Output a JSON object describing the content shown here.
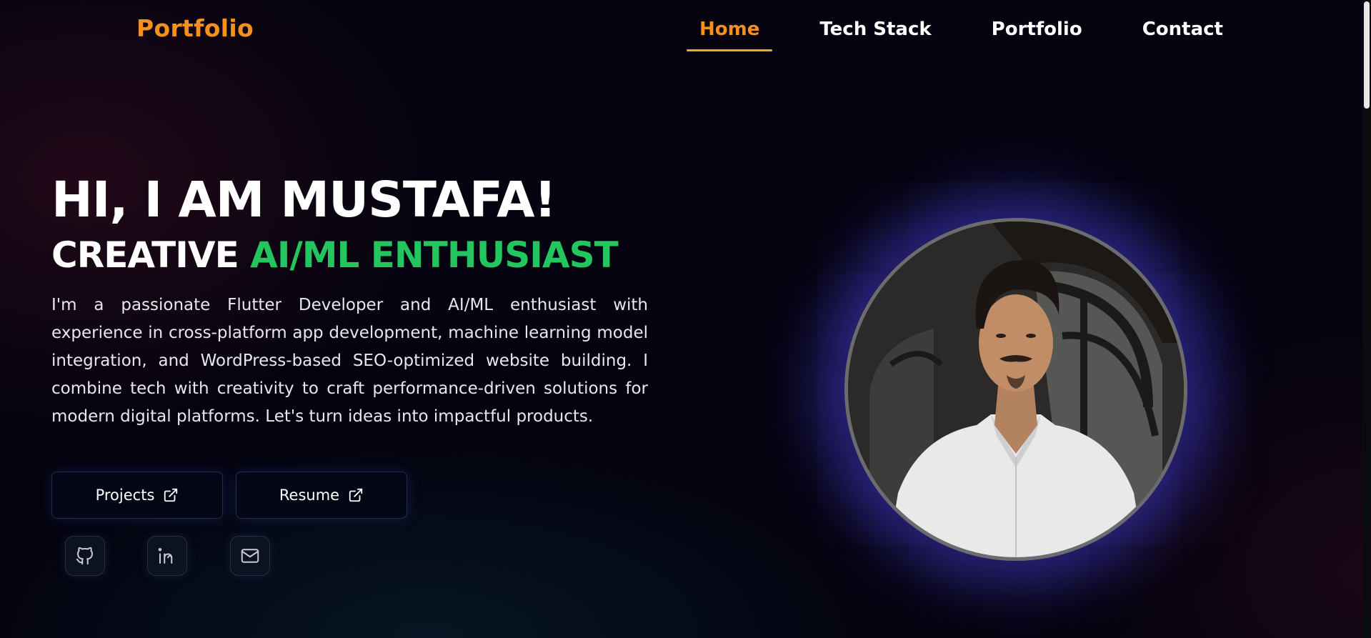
{
  "header": {
    "brand": "Portfolio",
    "nav": [
      {
        "label": "Home",
        "active": true
      },
      {
        "label": "Tech Stack",
        "active": false
      },
      {
        "label": "Portfolio",
        "active": false
      },
      {
        "label": "Contact",
        "active": false
      }
    ]
  },
  "hero": {
    "title": "HI, I AM MUSTAFA!",
    "subtitle_prefix": "CREATIVE",
    "subtitle_accent": "AI/ML ENTHUSIAST",
    "description": "I'm a passionate Flutter Developer and AI/ML enthusiast with experience in cross-platform app development, machine learning model integration, and WordPress-based SEO-optimized website building. I combine tech with creativity to craft performance-driven solutions for modern digital platforms. Let's turn ideas into impactful products.",
    "buttons": {
      "projects_label": "Projects",
      "resume_label": "Resume",
      "icon": "external-link-icon"
    },
    "socials": [
      "github-icon",
      "linkedin-icon",
      "mail-icon"
    ]
  },
  "colors": {
    "accent_orange": "#f5901e",
    "accent_green": "#22c55e",
    "background": "#04030f",
    "glow": "#5046e6"
  }
}
